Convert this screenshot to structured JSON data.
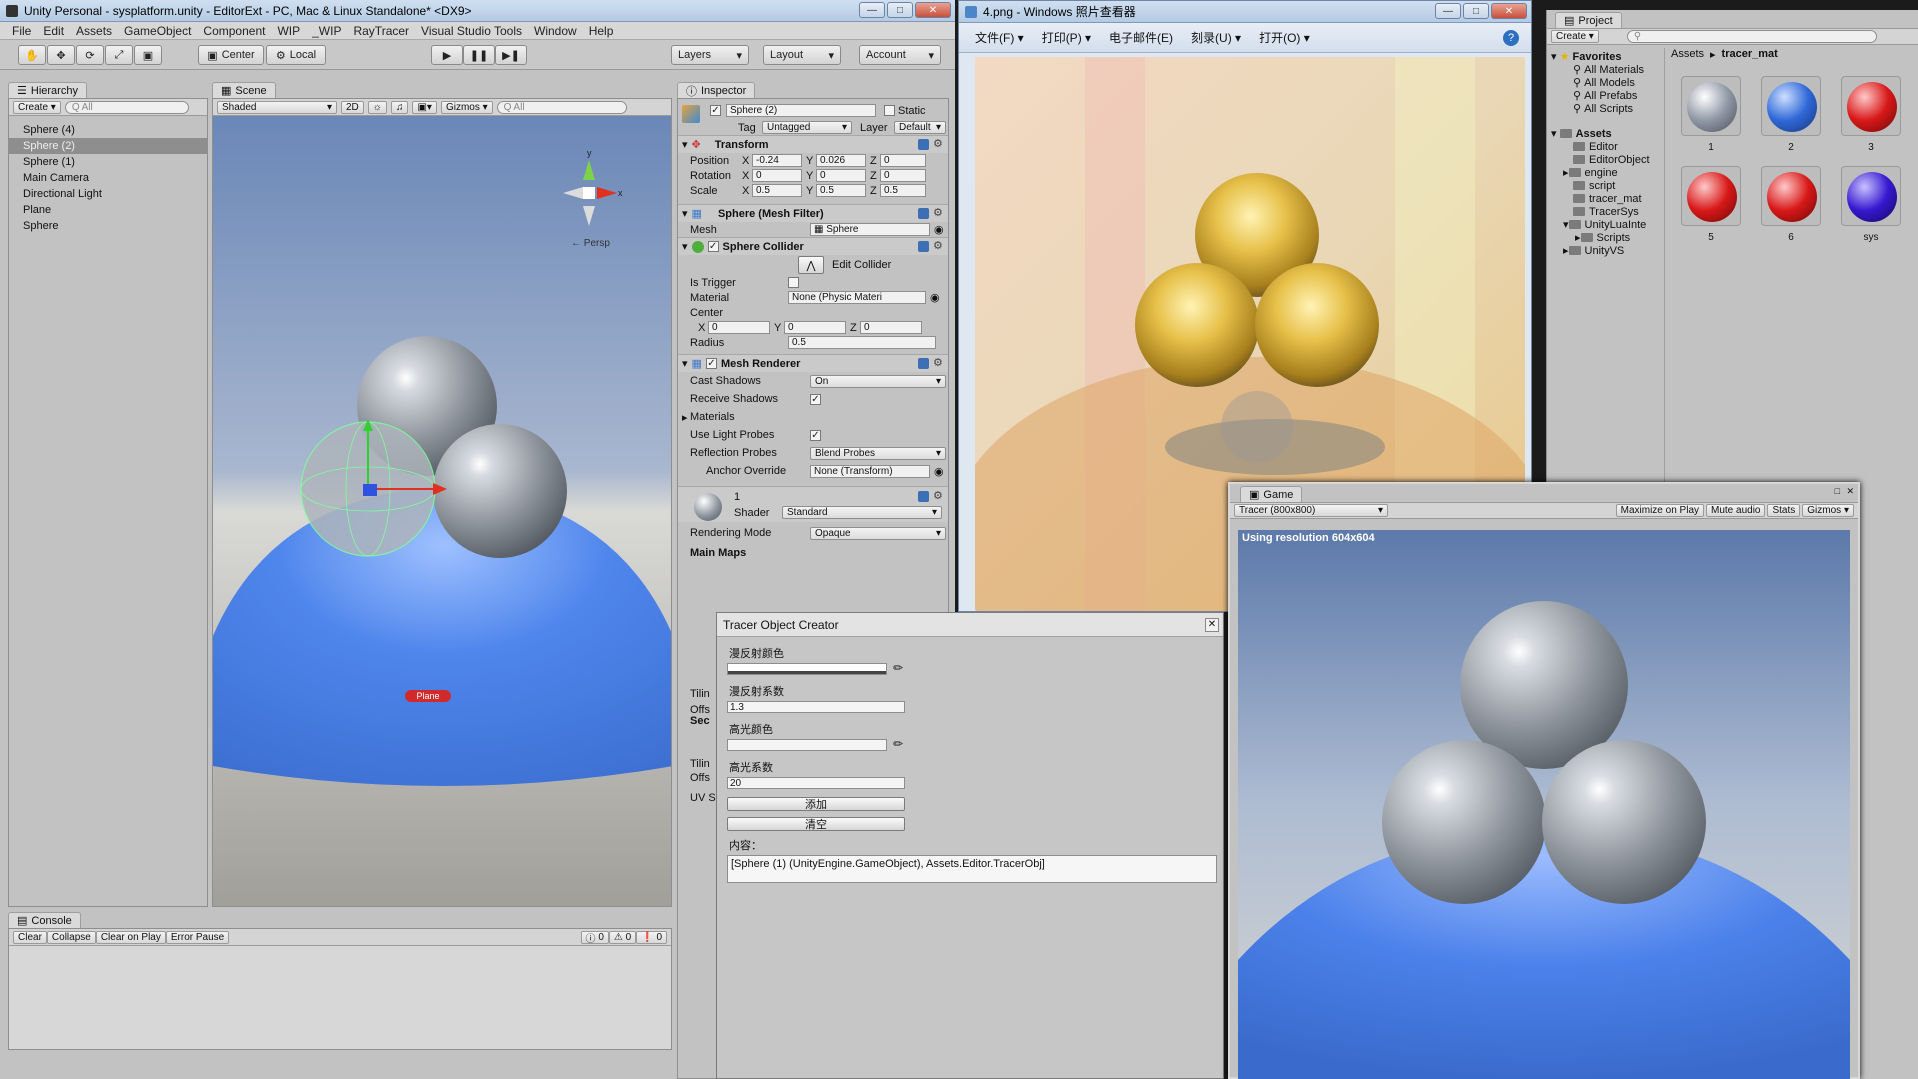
{
  "unity_window": {
    "title": "Unity Personal - sysplatform.unity - EditorExt - PC, Mac & Linux Standalone* <DX9>",
    "menu": [
      "File",
      "Edit",
      "Assets",
      "GameObject",
      "Component",
      "WIP",
      "_WIP",
      "RayTracer",
      "Visual Studio Tools",
      "Window",
      "Help"
    ],
    "toolbar": {
      "pivot": "Center",
      "space": "Local",
      "layers": "Layers",
      "layout": "Layout",
      "account": "Account"
    }
  },
  "hierarchy": {
    "tab": "Hierarchy",
    "create": "Create",
    "search_placeholder": "Q All",
    "items": [
      {
        "label": "Sphere (4)",
        "selected": false
      },
      {
        "label": "Sphere (2)",
        "selected": true
      },
      {
        "label": "Sphere (1)",
        "selected": false
      },
      {
        "label": "Main Camera",
        "selected": false
      },
      {
        "label": "Directional Light",
        "selected": false
      },
      {
        "label": "Plane",
        "selected": false
      },
      {
        "label": "Sphere",
        "selected": false
      }
    ]
  },
  "scene": {
    "tab": "Scene",
    "shading": "Shaded",
    "mode2d": "2D",
    "gizmos": "Gizmos",
    "search_placeholder": "Q All",
    "persp": "← Persp",
    "plane_label": "Plane",
    "axis_x": "x",
    "axis_y": "y"
  },
  "inspector": {
    "tab": "Inspector",
    "object_name": "Sphere (2)",
    "static_label": "Static",
    "tag_label": "Tag",
    "tag_value": "Untagged",
    "layer_label": "Layer",
    "layer_value": "Default",
    "transform": {
      "header": "Transform",
      "position_label": "Position",
      "pos_x": "-0.24",
      "pos_y": "0.026",
      "pos_z": "0",
      "rotation_label": "Rotation",
      "rot_x": "0",
      "rot_y": "0",
      "rot_z": "0",
      "scale_label": "Scale",
      "scale_x": "0.5",
      "scale_y": "0.5",
      "scale_z": "0.5"
    },
    "mesh_filter": {
      "header": "Sphere (Mesh Filter)",
      "mesh_label": "Mesh",
      "mesh_value": "Sphere"
    },
    "collider": {
      "header": "Sphere Collider",
      "edit_label": "Edit Collider",
      "trigger_label": "Is Trigger",
      "material_label": "Material",
      "material_value": "None (Physic Materi",
      "center_label": "Center",
      "cx": "0",
      "cy": "0",
      "cz": "0",
      "radius_label": "Radius",
      "radius_value": "0.5"
    },
    "renderer": {
      "header": "Mesh Renderer",
      "cast_label": "Cast Shadows",
      "cast_value": "On",
      "receive_label": "Receive Shadows",
      "materials_label": "Materials",
      "lightprobes_label": "Use Light Probes",
      "reflection_label": "Reflection Probes",
      "reflection_value": "Blend Probes",
      "anchor_label": "Anchor Override",
      "anchor_value": "None (Transform)"
    },
    "material": {
      "name": "1",
      "shader_label": "Shader",
      "shader_value": "Standard",
      "rendering_mode_label": "Rendering Mode",
      "rendering_mode_value": "Opaque",
      "main_maps": "Main Maps",
      "tiling": "Tilin",
      "offset": "Offs",
      "secondary": "Sec",
      "tiling2": "Tilin",
      "offset2": "Offs",
      "uvset": "UV S"
    }
  },
  "console": {
    "tab": "Console",
    "buttons": [
      "Clear",
      "Collapse",
      "Clear on Play",
      "Error Pause"
    ],
    "counts": {
      "log": "0",
      "warn": "0",
      "error": "0"
    }
  },
  "photo_viewer": {
    "title": "4.png - Windows 照片查看器",
    "menu": [
      "文件(F)",
      "打印(P)",
      "电子邮件(E)",
      "刻录(U)",
      "打开(O)"
    ]
  },
  "tracer_dialog": {
    "title": "Tracer Object Creator",
    "diffuse_color_label": "漫反射颜色",
    "diffuse_coef_label": "漫反射系数",
    "diffuse_coef_value": "1.3",
    "specular_color_label": "高光颜色",
    "specular_coef_label": "高光系数",
    "specular_coef_value": "20",
    "add_button": "添加",
    "clear_button": "清空",
    "content_label": "内容：",
    "content_value": "[Sphere (1) (UnityEngine.GameObject), Assets.Editor.TracerObj]"
  },
  "project": {
    "tab": "Project",
    "create": "Create",
    "breadcrumb_root": "Assets",
    "breadcrumb_current": "tracer_mat",
    "favorites_header": "Favorites",
    "favorites": [
      "All Materials",
      "All Models",
      "All Prefabs",
      "All Scripts"
    ],
    "assets_header": "Assets",
    "folders": [
      "Editor",
      "EditorObject",
      "engine",
      "script",
      "tracer_mat",
      "TracerSys",
      "UnityLuaInte",
      "Scripts",
      "UnityVS"
    ],
    "materials": [
      {
        "label": "1",
        "color": "#8f98a6"
      },
      {
        "label": "2",
        "color": "#2f68d8"
      },
      {
        "label": "3",
        "color": "#d81818"
      },
      {
        "label": "5",
        "color": "#d81818"
      },
      {
        "label": "6",
        "color": "#d81818"
      },
      {
        "label": "sys",
        "color": "#3618d0"
      }
    ]
  },
  "game": {
    "tab": "Game",
    "resolution_dropdown": "Tracer (800x800)",
    "maximize": "Maximize on Play",
    "mute": "Mute audio",
    "stats": "Stats",
    "gizmos": "Gizmos",
    "resolution_note": "Using resolution 604x604"
  }
}
